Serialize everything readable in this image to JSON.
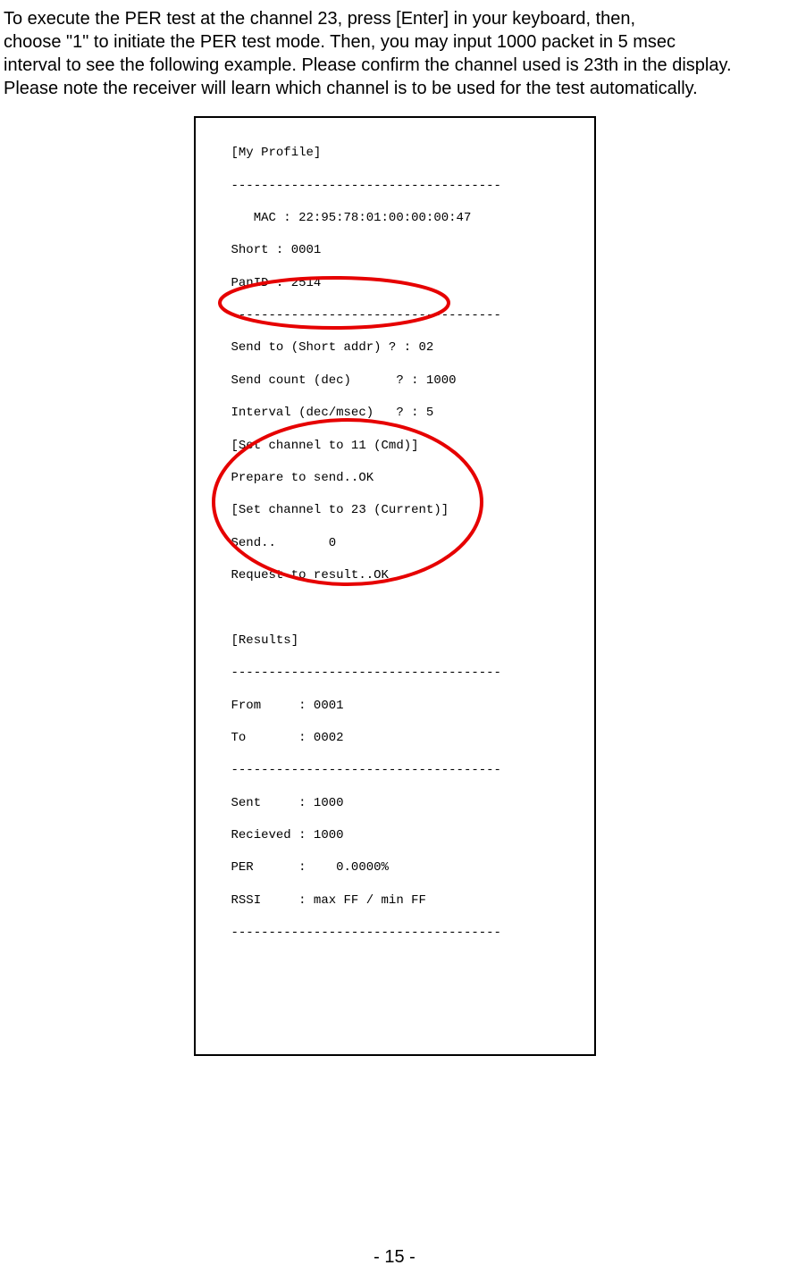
{
  "intro": {
    "line1": "To execute the PER test at the channel 23, press [Enter] in your keyboard, then,",
    "line2": "choose \"1\" to initiate the PER test mode. Then, you may input 1000 packet in 5 msec",
    "line3": "interval to see the following example. Please confirm the channel used is 23th in the display.",
    "line4": "Please note the receiver will learn which channel is to be used for the test automatically."
  },
  "terminal": {
    "l01": "[My Profile]",
    "l02": "------------------------------------",
    "l03": "   MAC : 22:95:78:01:00:00:00:47",
    "l04": "Short : 0001",
    "l05": "PanID : 2514",
    "l06": "------------------------------------",
    "l07": "Send to (Short addr) ? : 02",
    "l08": "Send count (dec)      ? : 1000",
    "l09": "Interval (dec/msec)   ? : 5",
    "l10": "[Set channel to 11 (Cmd)]",
    "l11": "Prepare to send..OK",
    "l12": "[Set channel to 23 (Current)]",
    "l13": "Send..       0",
    "l14": "Request to result..OK",
    "l15": "",
    "l16": "",
    "l17": "[Results]",
    "l18": "------------------------------------",
    "l19": "From     : 0001",
    "l20": "To       : 0002",
    "l21": "------------------------------------",
    "l22": "Sent     : 1000",
    "l23": "Recieved : 1000",
    "l24": "PER      :    0.0000%",
    "l25": "RSSI     : max FF / min FF",
    "l26": "------------------------------------"
  },
  "page_number": "- 15 -"
}
